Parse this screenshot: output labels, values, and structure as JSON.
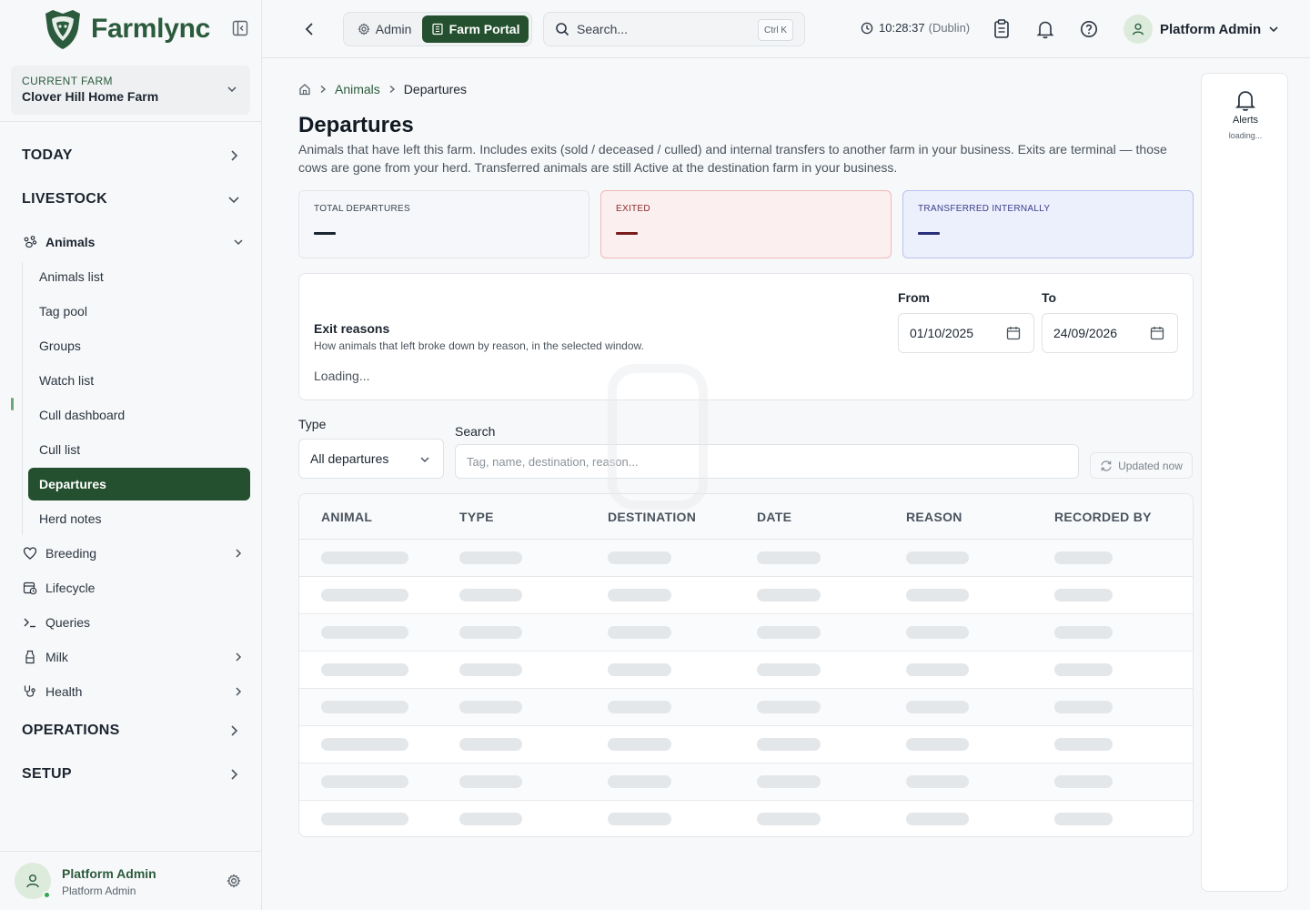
{
  "brand": {
    "name": "Farmlync"
  },
  "current_farm": {
    "label": "CURRENT FARM",
    "name": "Clover Hill Home Farm"
  },
  "nav": {
    "today": "TODAY",
    "livestock": "LIVESTOCK",
    "animals": "Animals",
    "animals_sub": [
      "Animals list",
      "Tag pool",
      "Groups",
      "Watch list",
      "Cull dashboard",
      "Cull list",
      "Departures",
      "Herd notes"
    ],
    "breeding": "Breeding",
    "lifecycle": "Lifecycle",
    "queries": "Queries",
    "milk": "Milk",
    "health": "Health",
    "operations": "OPERATIONS",
    "setup": "SETUP"
  },
  "footer_user": {
    "name": "Platform Admin",
    "role": "Platform Admin"
  },
  "topbar": {
    "admin_label": "Admin",
    "farm_portal_label": "Farm Portal",
    "search_placeholder": "Search...",
    "shortcut": "Ctrl K",
    "time": "10:28:37",
    "timezone": "(Dublin)",
    "user_name": "Platform Admin"
  },
  "breadcrumb": {
    "parent": "Animals",
    "current": "Departures"
  },
  "page": {
    "title": "Departures",
    "description": "Animals that have left this farm. Includes exits (sold / deceased / culled) and internal transfers to another farm in your business. Exits are terminal — those cows are gone from your herd. Transferred animals are still Active at the destination farm in your business."
  },
  "stats": [
    {
      "label": "TOTAL DEPARTURES",
      "value": "—"
    },
    {
      "label": "EXITED",
      "value": "—"
    },
    {
      "label": "TRANSFERRED INTERNALLY",
      "value": "—"
    }
  ],
  "exit_reasons": {
    "title": "Exit reasons",
    "subtitle": "How animals that left broke down by reason, in the selected window.",
    "loading": "Loading...",
    "from_label": "From",
    "from_value": "01/10/2025",
    "to_label": "To",
    "to_value": "24/09/2026"
  },
  "filters": {
    "type_label": "Type",
    "type_value": "All departures",
    "search_label": "Search",
    "search_placeholder": "Tag, name, destination, reason...",
    "updated": "Updated now"
  },
  "table": {
    "columns": [
      "ANIMAL",
      "TYPE",
      "DESTINATION",
      "DATE",
      "REASON",
      "RECORDED BY"
    ]
  },
  "alerts": {
    "title": "Alerts",
    "status": "loading..."
  },
  "colors": {
    "brand_green": "#24502f",
    "exited_bg": "#fcefef",
    "transfer_bg": "#eceffc"
  }
}
